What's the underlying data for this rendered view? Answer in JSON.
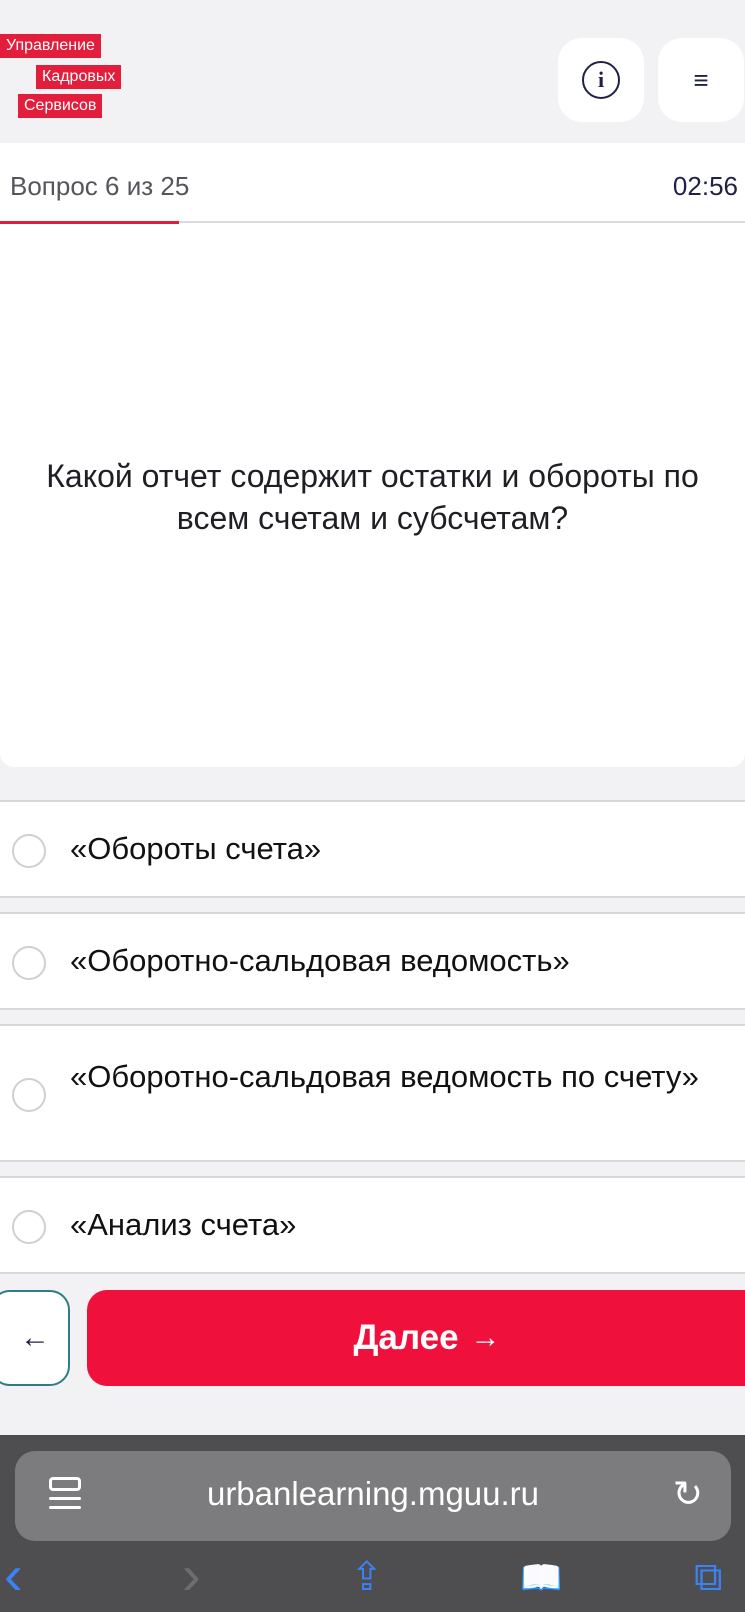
{
  "logo": {
    "line1": "Управление",
    "line2": "Кадровых",
    "line3": "Сервисов"
  },
  "header": {
    "info_icon": "info-icon",
    "info_glyph": "i",
    "menu_icon": "menu-icon",
    "menu_glyph": "≡"
  },
  "quiz": {
    "counter": "Вопрос 6 из 25",
    "timer": "02:56",
    "progress": 0.24,
    "question": "Какой отчет содержит остатки и обороты по всем счетам и субсчетам?",
    "options": [
      {
        "label": "«Обороты счета»",
        "selected": false
      },
      {
        "label": "«Оборотно-сальдовая ведомость»",
        "selected": false
      },
      {
        "label": "«Оборотно-сальдовая ведомость по счету»",
        "selected": false
      },
      {
        "label": "«Анализ счета»",
        "selected": false
      }
    ],
    "back_glyph": "←",
    "next_label": "Далее",
    "next_arrow": "→"
  },
  "browser": {
    "url": "urbanlearning.mguu.ru",
    "reload_glyph": "↻",
    "toolbar": {
      "back": "‹",
      "forward": "›",
      "share": "⇪",
      "bookmarks": "📖",
      "tabs": "⧉"
    }
  },
  "colors": {
    "accent": "#f0103c",
    "brand_red": "#e31e3c",
    "navy": "#1f2149"
  }
}
